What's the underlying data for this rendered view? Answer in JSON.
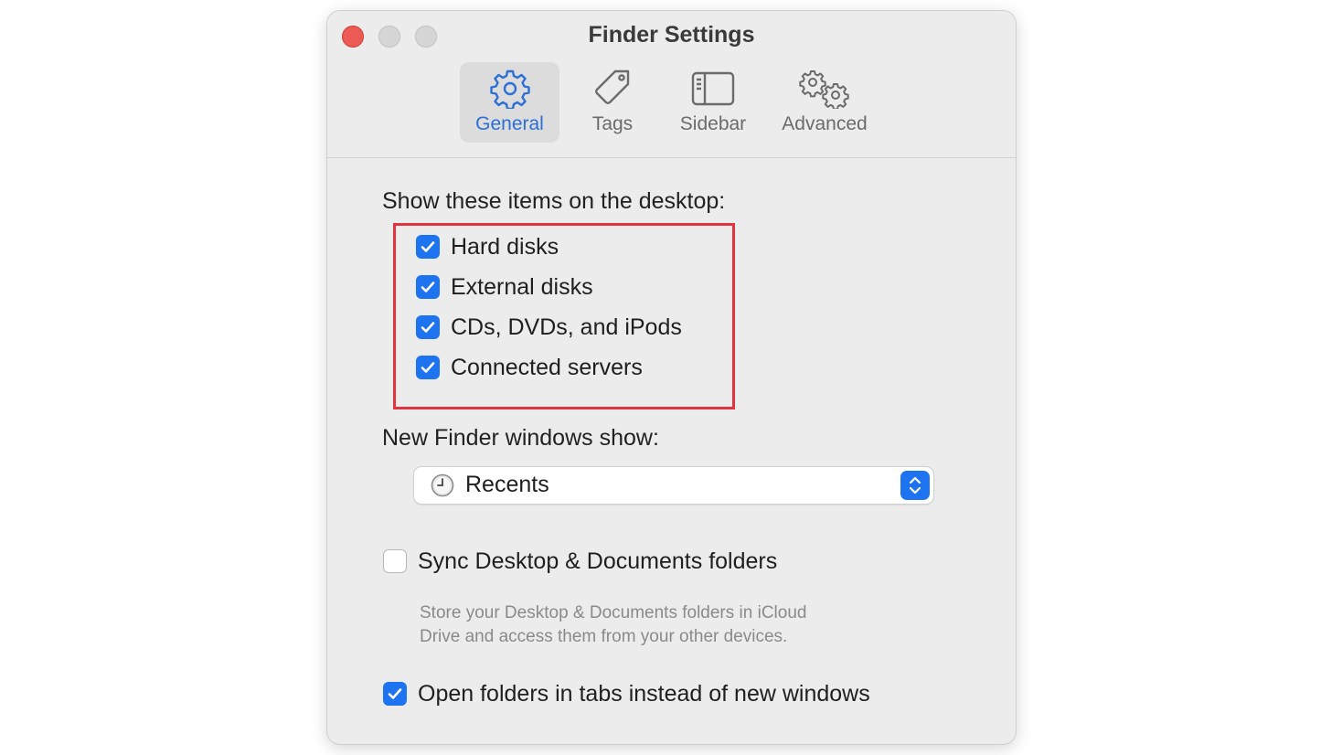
{
  "window": {
    "title": "Finder Settings"
  },
  "tabs": [
    {
      "label": "General",
      "icon": "gear-icon",
      "active": true
    },
    {
      "label": "Tags",
      "icon": "tag-icon",
      "active": false
    },
    {
      "label": "Sidebar",
      "icon": "sidebar-icon",
      "active": false
    },
    {
      "label": "Advanced",
      "icon": "gears-icon",
      "active": false
    }
  ],
  "desktop_items": {
    "heading": "Show these items on the desktop:",
    "items": [
      {
        "label": "Hard disks",
        "checked": true
      },
      {
        "label": "External disks",
        "checked": true
      },
      {
        "label": "CDs, DVDs, and iPods",
        "checked": true
      },
      {
        "label": "Connected servers",
        "checked": true
      }
    ]
  },
  "new_windows": {
    "heading": "New Finder windows show:",
    "selected": "Recents",
    "icon": "clock-icon"
  },
  "sync": {
    "label": "Sync Desktop & Documents folders",
    "checked": false,
    "description_line1": "Store your Desktop & Documents folders in iCloud",
    "description_line2": "Drive and access them from your other devices."
  },
  "open_in_tabs": {
    "label": "Open folders in tabs instead of new windows",
    "checked": true
  },
  "colors": {
    "accent": "#1e73f0",
    "highlight": "#e2343f",
    "close": "#ec5a56"
  }
}
